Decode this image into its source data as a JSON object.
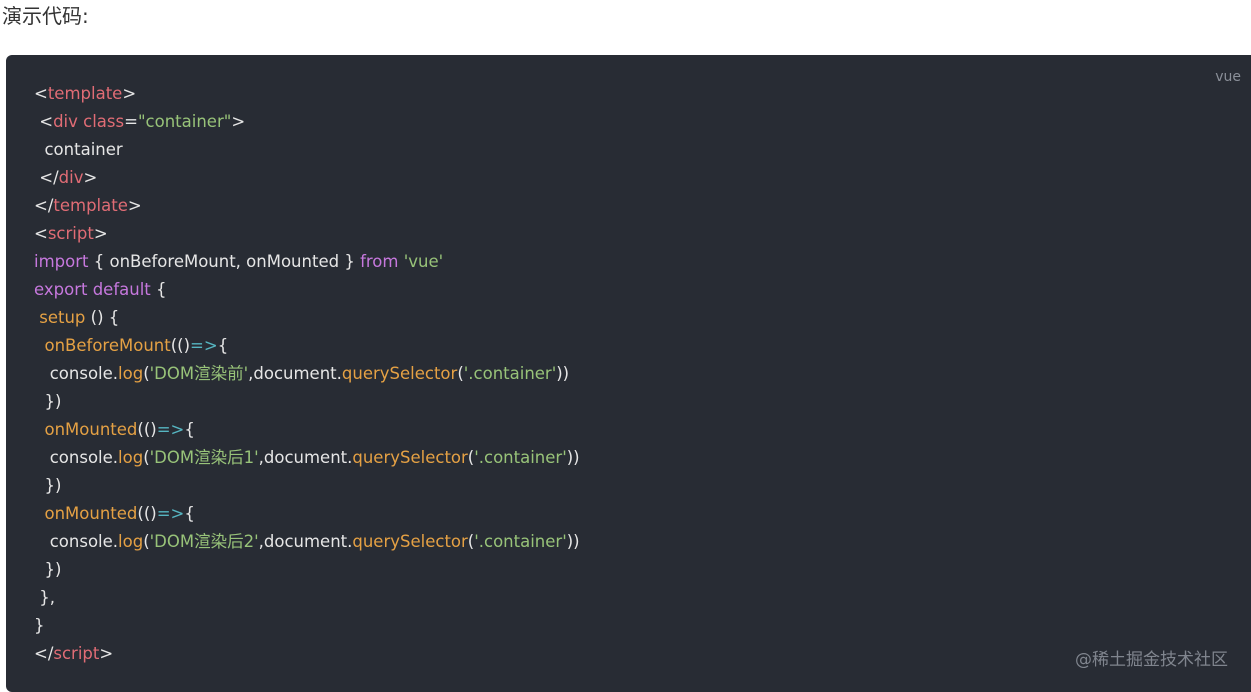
{
  "intro": {
    "text": "演示代码:"
  },
  "code_block": {
    "language": "vue",
    "watermark": "@稀土掘金技术社区",
    "lines": [
      [
        [
          "tag-punc",
          "<"
        ],
        [
          "tag",
          "template"
        ],
        [
          "tag-punc",
          ">"
        ]
      ],
      [
        [
          "plain",
          " "
        ],
        [
          "tag-punc",
          "<"
        ],
        [
          "tag",
          "div"
        ],
        [
          "plain",
          " "
        ],
        [
          "tag",
          "class"
        ],
        [
          "tag-punc",
          "="
        ],
        [
          "str",
          "\"container\""
        ],
        [
          "tag-punc",
          ">"
        ]
      ],
      [
        [
          "plain",
          "  container"
        ]
      ],
      [
        [
          "plain",
          " "
        ],
        [
          "tag-punc",
          "</"
        ],
        [
          "tag",
          "div"
        ],
        [
          "tag-punc",
          ">"
        ]
      ],
      [
        [
          "tag-punc",
          "</"
        ],
        [
          "tag",
          "template"
        ],
        [
          "tag-punc",
          ">"
        ]
      ],
      [
        [
          "tag-punc",
          "<"
        ],
        [
          "tag",
          "script"
        ],
        [
          "tag-punc",
          ">"
        ]
      ],
      [
        [
          "kw",
          "import"
        ],
        [
          "plain",
          " { onBeforeMount, onMounted } "
        ],
        [
          "kw",
          "from"
        ],
        [
          "plain",
          " "
        ],
        [
          "str",
          "'vue'"
        ]
      ],
      [
        [
          "kw",
          "export default"
        ],
        [
          "plain",
          " {"
        ]
      ],
      [
        [
          "plain",
          " "
        ],
        [
          "fn",
          "setup"
        ],
        [
          "plain",
          " () {"
        ]
      ],
      [
        [
          "plain",
          "  "
        ],
        [
          "fn",
          "onBeforeMount"
        ],
        [
          "plain",
          "(()"
        ],
        [
          "op",
          "=>"
        ],
        [
          "plain",
          "{"
        ]
      ],
      [
        [
          "plain",
          "   console."
        ],
        [
          "fn",
          "log"
        ],
        [
          "plain",
          "("
        ],
        [
          "str",
          "'DOM渲染前'"
        ],
        [
          "plain",
          ",document."
        ],
        [
          "fn",
          "querySelector"
        ],
        [
          "plain",
          "("
        ],
        [
          "str",
          "'.container'"
        ],
        [
          "plain",
          "))"
        ]
      ],
      [
        [
          "plain",
          "  })"
        ]
      ],
      [
        [
          "plain",
          "  "
        ],
        [
          "fn",
          "onMounted"
        ],
        [
          "plain",
          "(()"
        ],
        [
          "op",
          "=>"
        ],
        [
          "plain",
          "{"
        ]
      ],
      [
        [
          "plain",
          "   console."
        ],
        [
          "fn",
          "log"
        ],
        [
          "plain",
          "("
        ],
        [
          "str",
          "'DOM渲染后1'"
        ],
        [
          "plain",
          ",document."
        ],
        [
          "fn",
          "querySelector"
        ],
        [
          "plain",
          "("
        ],
        [
          "str",
          "'.container'"
        ],
        [
          "plain",
          "))"
        ]
      ],
      [
        [
          "plain",
          "  })"
        ]
      ],
      [
        [
          "plain",
          "  "
        ],
        [
          "fn",
          "onMounted"
        ],
        [
          "plain",
          "(()"
        ],
        [
          "op",
          "=>"
        ],
        [
          "plain",
          "{"
        ]
      ],
      [
        [
          "plain",
          "   console."
        ],
        [
          "fn",
          "log"
        ],
        [
          "plain",
          "("
        ],
        [
          "str",
          "'DOM渲染后2'"
        ],
        [
          "plain",
          ",document."
        ],
        [
          "fn",
          "querySelector"
        ],
        [
          "plain",
          "("
        ],
        [
          "str",
          "'.container'"
        ],
        [
          "plain",
          "))"
        ]
      ],
      [
        [
          "plain",
          "  })"
        ]
      ],
      [
        [
          "plain",
          " },"
        ]
      ],
      [
        [
          "plain",
          "}"
        ]
      ],
      [
        [
          "tag-punc",
          "</"
        ],
        [
          "tag",
          "script"
        ],
        [
          "tag-punc",
          ">"
        ]
      ]
    ]
  },
  "colors": {
    "background": "#282c34",
    "tag": "#e06c75",
    "keyword": "#c678dd",
    "function": "#e5a144",
    "string": "#98c379",
    "operator": "#56b6c2"
  }
}
